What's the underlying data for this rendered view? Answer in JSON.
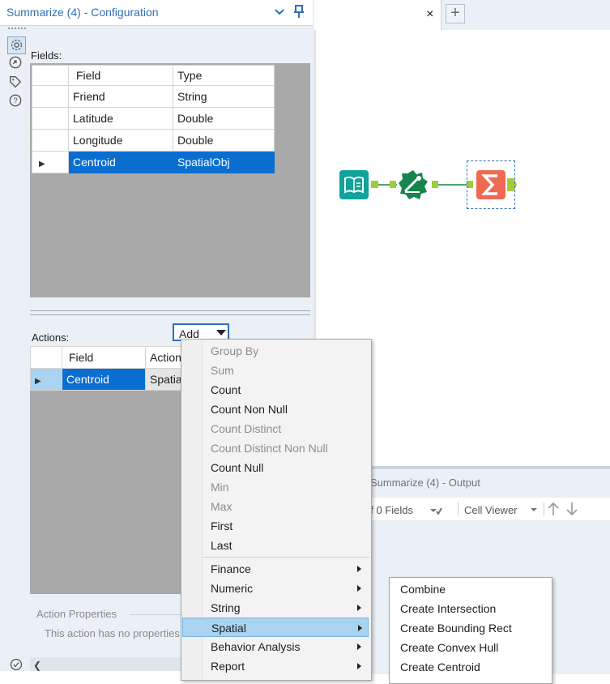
{
  "config": {
    "title": "Summarize (4) - Configuration",
    "fields_label": "Fields:",
    "fields_columns": [
      "Field",
      "Type"
    ],
    "fields_rows": [
      {
        "field": "Friend",
        "type": "String"
      },
      {
        "field": "Latitude",
        "type": "Double"
      },
      {
        "field": "Longitude",
        "type": "Double"
      },
      {
        "field": "Centroid",
        "type": "SpatialObj",
        "selected": true
      }
    ],
    "actions_label": "Actions:",
    "add_button": "Add",
    "actions_columns": [
      "Field",
      "Action"
    ],
    "actions_rows": [
      {
        "field": "Centroid",
        "action": "Spatial"
      }
    ],
    "action_properties_title": "Action Properties",
    "action_properties_text": "This action has no properties"
  },
  "side_icons": [
    "gear-icon",
    "navigate-icon",
    "tag-icon",
    "help-icon"
  ],
  "canvas": {
    "tab_close": "×",
    "new_tab": "+"
  },
  "output": {
    "title": "Summarize (4) - Output",
    "fields_count": "of 0 Fields",
    "cell_viewer": "Cell Viewer"
  },
  "add_menu": {
    "aggregations": [
      {
        "label": "Group By",
        "enabled": false
      },
      {
        "label": "Sum",
        "enabled": false
      },
      {
        "label": "Count",
        "enabled": true
      },
      {
        "label": "Count Non Null",
        "enabled": true
      },
      {
        "label": "Count Distinct",
        "enabled": false
      },
      {
        "label": "Count Distinct Non Null",
        "enabled": false
      },
      {
        "label": "Count Null",
        "enabled": true
      },
      {
        "label": "Min",
        "enabled": false
      },
      {
        "label": "Max",
        "enabled": false
      },
      {
        "label": "First",
        "enabled": true
      },
      {
        "label": "Last",
        "enabled": true
      }
    ],
    "categories": [
      {
        "label": "Finance"
      },
      {
        "label": "Numeric"
      },
      {
        "label": "String"
      },
      {
        "label": "Spatial",
        "highlighted": true
      },
      {
        "label": "Behavior Analysis"
      },
      {
        "label": "Report"
      }
    ]
  },
  "spatial_submenu": [
    "Combine",
    "Create Intersection",
    "Create Bounding Rect",
    "Create Convex Hull",
    "Create Centroid"
  ],
  "colors": {
    "selection": "#0a6ed1",
    "menu_highlight": "#a9d3f0",
    "input_tool": "#10a29b",
    "spatial_tool": "#16854b",
    "summarize_tool": "#ee6a52",
    "connector": "#9fcc3b"
  }
}
